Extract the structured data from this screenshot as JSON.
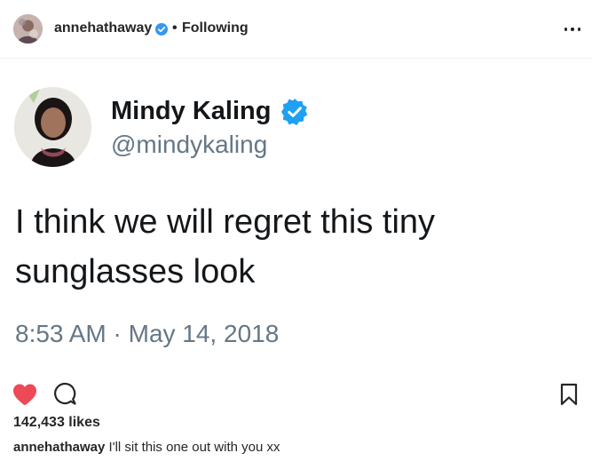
{
  "post": {
    "header": {
      "username": "annehathaway",
      "dot": "•",
      "follow_status": "Following"
    },
    "tweet": {
      "name": "Mindy Kaling",
      "handle": "@mindykaling",
      "text": "I think we will regret this tiny sunglasses look",
      "time": "8:53 AM · May 14, 2018"
    },
    "likes": "142,433 likes",
    "caption": {
      "username": "annehathaway",
      "text": " I'll sit this one out with you xx"
    }
  },
  "colors": {
    "heart": "#ed4956",
    "verified": "#3897f0",
    "tweet_verified": "#1da1f2",
    "text": "#262626",
    "tweet_gray": "#657786"
  },
  "icons": [
    "verified-badge-icon",
    "more-options-icon",
    "heart-icon",
    "comment-icon",
    "bookmark-icon"
  ]
}
